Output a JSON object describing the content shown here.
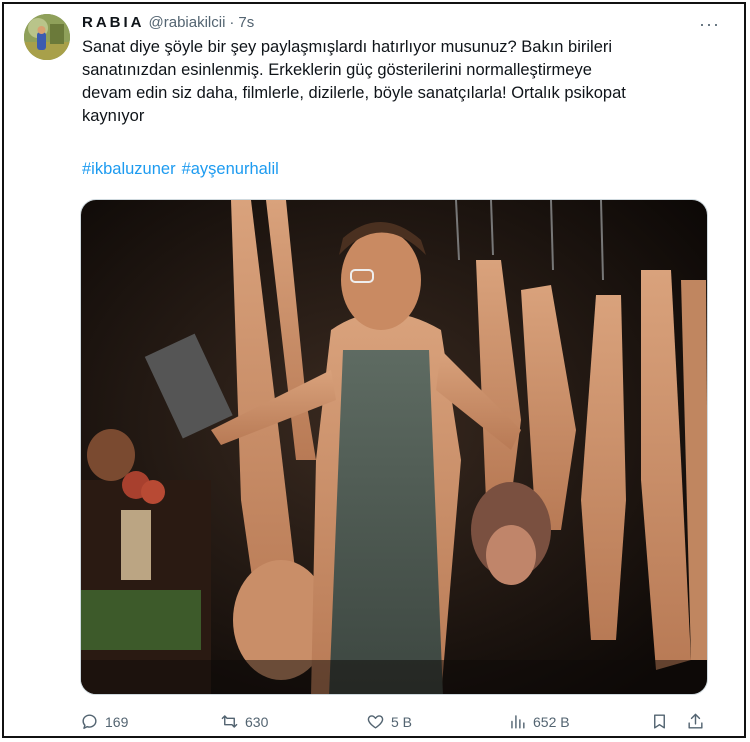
{
  "tweet": {
    "display_name": "RABIA",
    "handle": "@rabiakilcii",
    "separator": "·",
    "time": "7s",
    "more": "···",
    "text_lines": [
      "Sanat diye şöyle bir şey paylaşmışlardı hatırlıyor musunuz? Bakın birileri",
      "sanatınızdan esinlenmiş. Erkeklerin güç gösterilerini normalleştirmeye",
      "devam edin siz daha, filmlerle, dizilerle, böyle sanatçılarla! Ortalık psikopat",
      "kaynıyor"
    ],
    "hashtags": [
      "#ikbaluzuner",
      "#ayşenurhalil"
    ]
  },
  "actions": {
    "replies": "169",
    "reposts": "630",
    "likes": "5 B",
    "views": "652 B"
  },
  "icons": {
    "reply": "reply-icon",
    "repost": "repost-icon",
    "like": "heart-icon",
    "views": "views-chart-icon",
    "bookmark": "bookmark-icon",
    "share": "share-icon",
    "more": "more-icon"
  },
  "colors": {
    "link": "#1d9bf0",
    "muted": "#536471",
    "text": "#0f1419"
  }
}
